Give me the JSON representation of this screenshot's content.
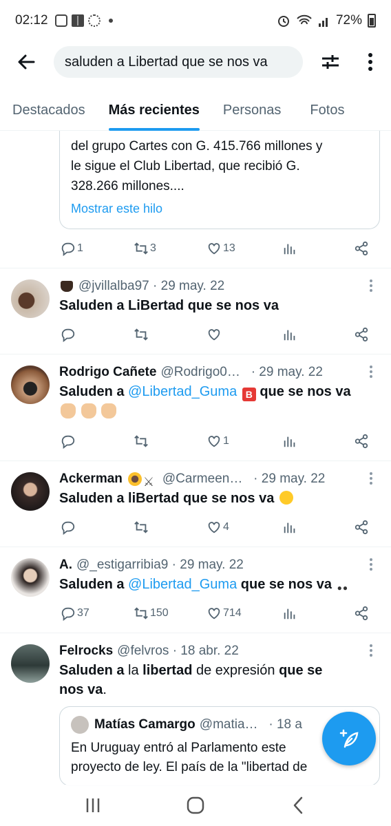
{
  "status": {
    "time": "02:12",
    "battery": "72%"
  },
  "search": {
    "query": "saluden a Libertad que se nos va"
  },
  "tabs": [
    {
      "label": "Destacados"
    },
    {
      "label": "Más recientes"
    },
    {
      "label": "Personas"
    },
    {
      "label": "Fotos"
    }
  ],
  "first": {
    "text_line1": "del grupo Cartes con G. 415.766 millones y",
    "text_line2": "le sigue el Club Libertad, que recibió G.",
    "text_line3": "328.266 millones....",
    "show_thread": "Mostrar este hilo",
    "replies": "1",
    "retweets": "3",
    "likes": "13"
  },
  "tweets": [
    {
      "name": "",
      "handle": "@jvillalba97",
      "date": "· 29 may. 22",
      "text": "Saluden a LiBertad que se nos va",
      "replies": "",
      "retweets": "",
      "likes": ""
    },
    {
      "name": "Rodrigo Cañete",
      "handle": "@Rodrigo0…",
      "date": "· 29 may. 22",
      "text_a": "Saluden a ",
      "mention": "@Libertad_Guma",
      "text_b": " que se nos va",
      "replies": "",
      "retweets": "",
      "likes": "1"
    },
    {
      "name": "Ackerman",
      "handle": "@Carmeen…",
      "date": "· 29 may. 22",
      "text": "Saluden a liBertad que se nos va",
      "replies": "",
      "retweets": "",
      "likes": "4"
    },
    {
      "name": "A.",
      "handle": "@_estigarribia9",
      "date": "· 29 may. 22",
      "text_a": "Saluden a ",
      "mention": "@Libertad_Guma",
      "text_b": " que se nos va",
      "replies": "37",
      "retweets": "150",
      "likes": "714"
    },
    {
      "name": "Felrocks",
      "handle": "@felvros",
      "date": "· 18 abr. 22",
      "t1": "Saluden a",
      "t2": " la ",
      "t3": "libertad",
      "t4": " de expresión ",
      "t5": "que se",
      "t6": "nos va",
      "t7": ".",
      "quote": {
        "name": "Matías Camargo",
        "handle": "@matia…",
        "date": "· 18 a",
        "line1": "En Uruguay entró al Parlamento este",
        "line2": "proyecto de ley. El país de la \"libertad de"
      }
    }
  ],
  "colors": {
    "accent": "#1d9bf0",
    "text": "#0f1419",
    "muted": "#536471"
  }
}
